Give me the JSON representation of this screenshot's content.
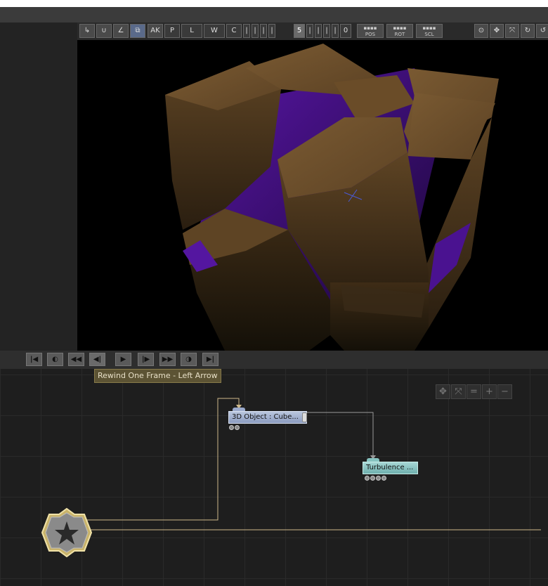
{
  "toolbar": {
    "buttons": [
      "↳",
      "∪",
      "∠",
      "⧉",
      "AK",
      "P",
      "L",
      "W",
      "C",
      "|",
      "|",
      "|",
      "|",
      "5",
      "|",
      "|",
      "|",
      "|",
      "0"
    ],
    "locks": [
      "POS",
      "ROT",
      "SCL"
    ],
    "right_icons": [
      "target-icon",
      "move-icon",
      "fit-icon",
      "rotate-cw-icon",
      "undo-icon"
    ]
  },
  "transport": {
    "buttons": [
      "first-frame",
      "prev-key",
      "rewind",
      "rewind-one-frame",
      "play",
      "forward-one-frame",
      "fast-forward",
      "next-key",
      "last-frame"
    ],
    "glyphs": [
      "|◀",
      "◐",
      "◀◀",
      "◀|",
      "▶",
      "|▶",
      "▶▶",
      "◑",
      "▶|"
    ]
  },
  "tooltip": "Rewind One Frame - Left Arrow",
  "flow_controls": [
    "✥",
    "⤧",
    "=",
    "+",
    "−"
  ],
  "nodes": {
    "object": "3D  Object  :  Cube...",
    "turbulence": "Turbulence  ..."
  },
  "colors": {
    "accent_purple": "#5a16a8",
    "brown": "#6a4a24",
    "node_blue": "#9aa9cb",
    "node_teal": "#86c3c0",
    "wire": "#cdb88a"
  }
}
